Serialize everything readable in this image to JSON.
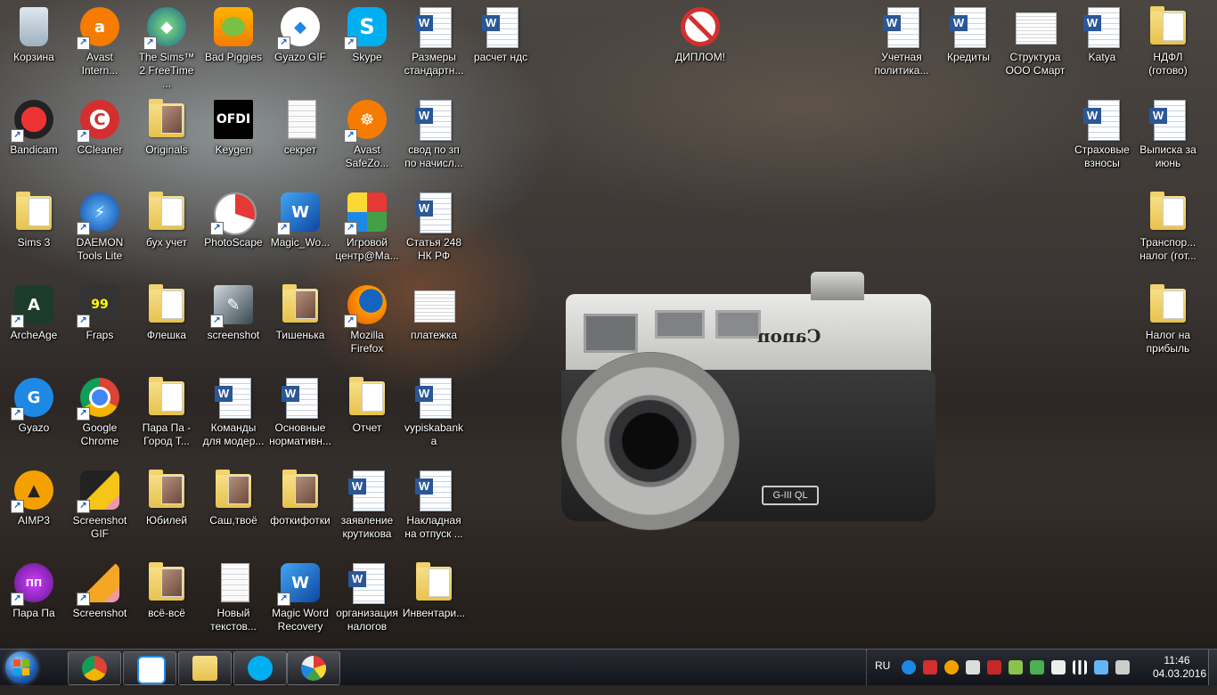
{
  "desktop": {
    "icons": [
      {
        "label": "Корзина"
      },
      {
        "label": "Avast Intern..."
      },
      {
        "label": "The Sims™ 2 FreeTime ..."
      },
      {
        "label": "Bad Piggies"
      },
      {
        "label": "Gyazo GIF"
      },
      {
        "label": "Skype"
      },
      {
        "label": "Размеры стандартн..."
      },
      {
        "label": "расчет ндс"
      },
      {
        "label": "ДИПЛОМ!"
      },
      {
        "label": "Учетная политика..."
      },
      {
        "label": "Кредиты"
      },
      {
        "label": "Структура ООО Смарт"
      },
      {
        "label": "Katya"
      },
      {
        "label": "НДФЛ (готово)"
      },
      {
        "label": "Bandicam"
      },
      {
        "label": "CCleaner"
      },
      {
        "label": "Originals"
      },
      {
        "label": "Keygen"
      },
      {
        "label": "секрет"
      },
      {
        "label": "Avast SafeZo..."
      },
      {
        "label": "свод по зп по начисл..."
      },
      {
        "label": "Страховые взносы"
      },
      {
        "label": "Выписка за июнь"
      },
      {
        "label": "Sims 3"
      },
      {
        "label": "DAEMON Tools Lite"
      },
      {
        "label": "бух учет"
      },
      {
        "label": "PhotoScape"
      },
      {
        "label": "Magic_Wo..."
      },
      {
        "label": "Игровой центр@Ма..."
      },
      {
        "label": "Статья 248 НК РФ"
      },
      {
        "label": "Транспор... налог (гот..."
      },
      {
        "label": "ArcheAge"
      },
      {
        "label": "Fraps"
      },
      {
        "label": "Флешка"
      },
      {
        "label": "screenshot"
      },
      {
        "label": "Тишенька"
      },
      {
        "label": "Mozilla Firefox"
      },
      {
        "label": "платежка"
      },
      {
        "label": "Налог на прибыль"
      },
      {
        "label": "Gyazo"
      },
      {
        "label": "Google Chrome"
      },
      {
        "label": "Пара Па - Город Т..."
      },
      {
        "label": "Команды для модер..."
      },
      {
        "label": "Основные нормативн..."
      },
      {
        "label": "Отчет"
      },
      {
        "label": "vypiskabanka"
      },
      {
        "label": "AIMP3"
      },
      {
        "label": "Screenshot GIF"
      },
      {
        "label": "Юбилей"
      },
      {
        "label": "Саш,твоё"
      },
      {
        "label": "фоткифотки"
      },
      {
        "label": "заявление крутикова"
      },
      {
        "label": "Накладная на отпуск ..."
      },
      {
        "label": "Пара Па"
      },
      {
        "label": "Screenshot"
      },
      {
        "label": "всё-всё"
      },
      {
        "label": "Новый текстов..."
      },
      {
        "label": "Magic Word Recovery"
      },
      {
        "label": "организация налогов"
      },
      {
        "label": "Инвентари..."
      }
    ],
    "wallpaper_brand": "Canon",
    "wallpaper_badge": "G-III QL"
  },
  "taskbar": {
    "pinned": [
      "Google Chrome",
      "Gyazo",
      "Windows Explorer",
      "Skype",
      "Paint"
    ],
    "language": "RU",
    "time": "11:46",
    "date": "04.03.2016"
  },
  "colors": {
    "word_blue": "#2b5797",
    "folder_yellow": "#e7c24c",
    "taskbar": "#1c1f26"
  }
}
